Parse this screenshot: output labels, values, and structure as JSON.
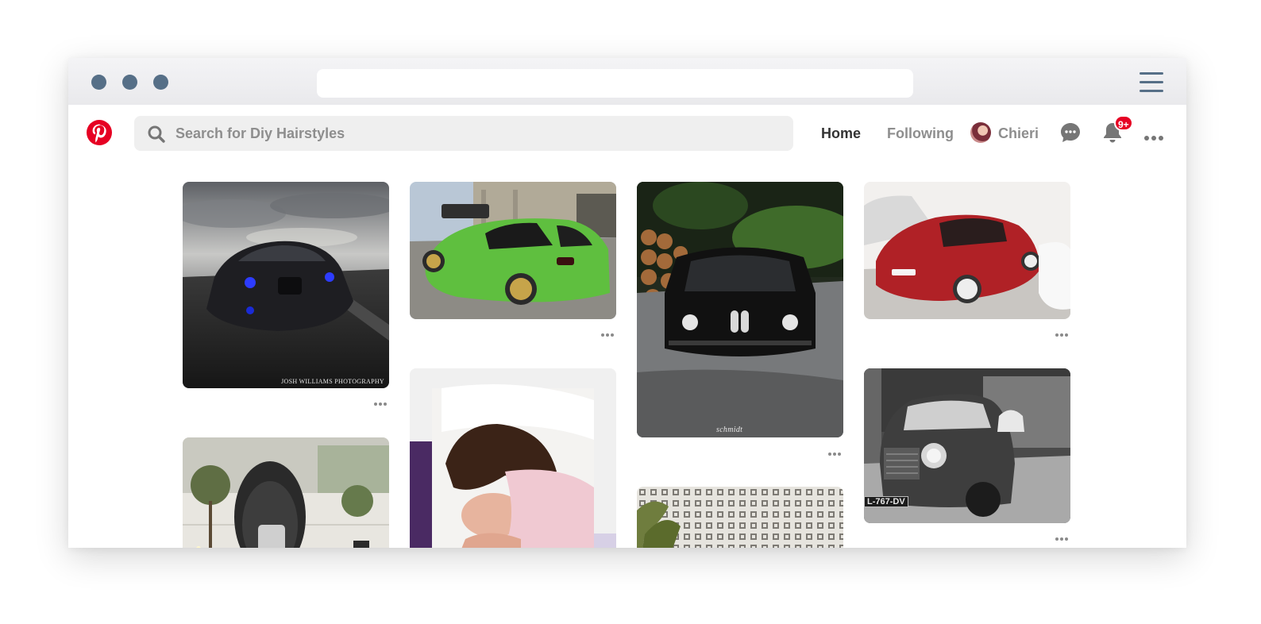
{
  "window": {
    "controls": [
      "close-dot",
      "minimize-dot",
      "maximize-dot"
    ],
    "url": ""
  },
  "header": {
    "search_placeholder": "Search for Diy Hairstyles",
    "nav_home": "Home",
    "nav_following": "Following",
    "user_name": "Chieri",
    "notification_badge": "9+"
  },
  "pins": [
    {
      "name": "pin-black-subaru-sti",
      "credit": "JOSH WILLIAMS PHOTOGRAPHY"
    },
    {
      "name": "pin-green-subaru-wagon",
      "credit": ""
    },
    {
      "name": "pin-black-bmw-2002",
      "credit": "schmidt"
    },
    {
      "name": "pin-red-subaru-impreza",
      "credit": ""
    },
    {
      "name": "pin-balcony-egg-chair",
      "credit": ""
    },
    {
      "name": "pin-sleeping-woman",
      "credit": ""
    },
    {
      "name": "pin-mini-cooper",
      "credit": "L-767-DV"
    },
    {
      "name": "pin-breeze-block-wall",
      "credit": ""
    }
  ],
  "colors": {
    "brand": "#e60023",
    "window_controls": "#566f87",
    "active_nav": "#333333",
    "inactive_nav": "#8e8e8e"
  },
  "icons": [
    "pinterest-logo-icon",
    "search-icon",
    "chat-bubble-icon",
    "bell-icon",
    "more-icon",
    "hamburger-menu-icon"
  ]
}
